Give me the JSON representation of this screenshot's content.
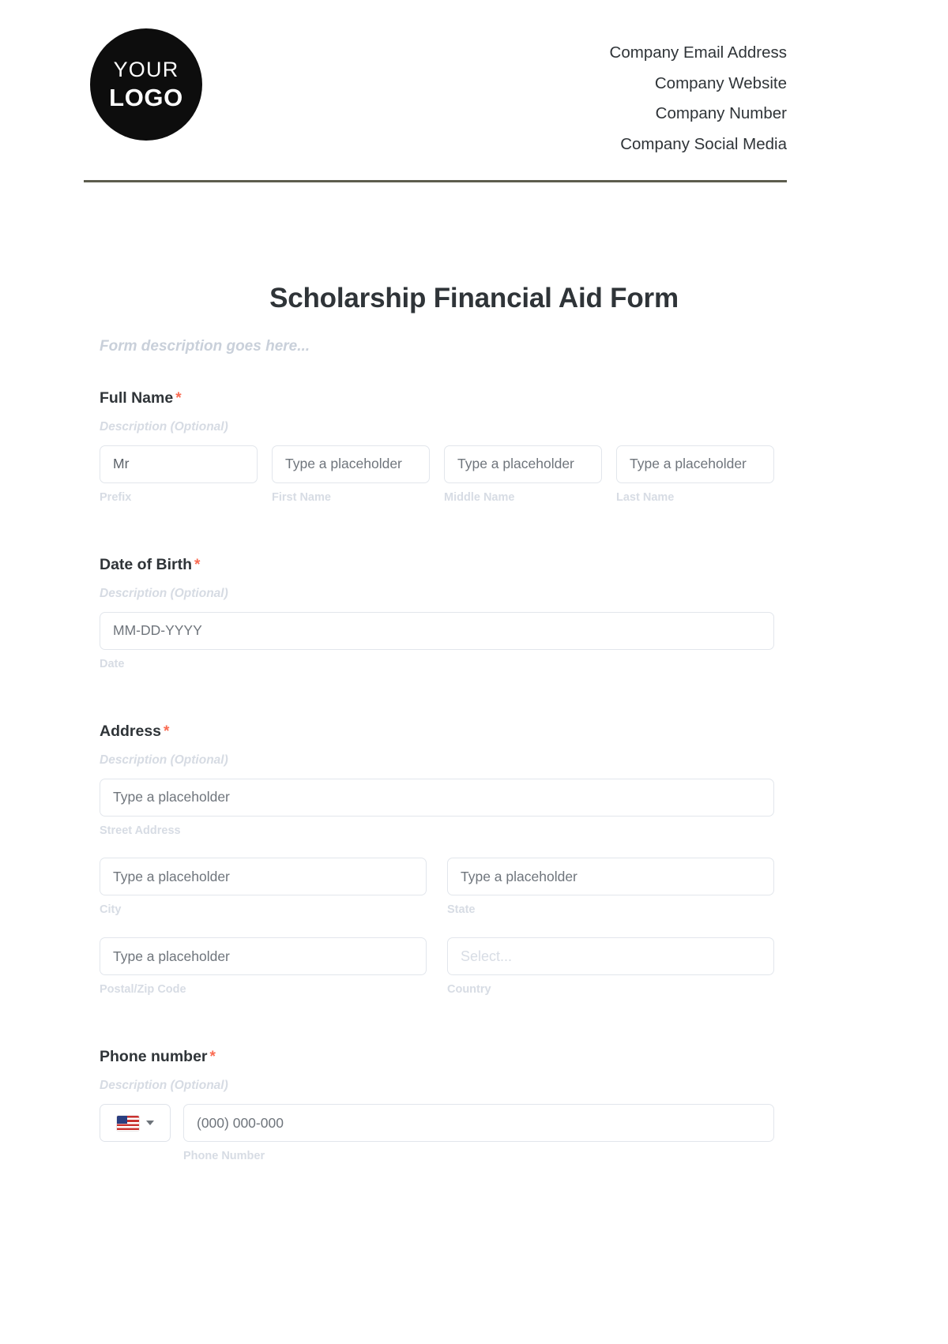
{
  "header": {
    "logo": {
      "line1": "YOUR",
      "line2": "LOGO"
    },
    "contact_lines": [
      "Company Email Address",
      "Company Website",
      "Company Number",
      "Company Social Media"
    ]
  },
  "form": {
    "title": "Scholarship Financial Aid Form",
    "description": "Form description goes here...",
    "required_marker": "*",
    "optional_description": "Description (Optional)",
    "fields": {
      "full_name": {
        "label": "Full Name",
        "description": "Description (Optional)",
        "parts": [
          {
            "value": "Mr",
            "sublabel": "Prefix"
          },
          {
            "value": "Type a placeholder",
            "sublabel": "First Name"
          },
          {
            "value": "Type a placeholder",
            "sublabel": "Middle Name"
          },
          {
            "value": "Type a placeholder",
            "sublabel": "Last Name"
          }
        ]
      },
      "date_of_birth": {
        "label": "Date of Birth",
        "description": "Description (Optional)",
        "value": "MM-DD-YYYY",
        "sublabel": "Date"
      },
      "address": {
        "label": "Address",
        "description": "Description (Optional)",
        "street": {
          "value": "Type a placeholder",
          "sublabel": "Street Address"
        },
        "city": {
          "value": "Type a placeholder",
          "sublabel": "City"
        },
        "state": {
          "value": "Type a placeholder",
          "sublabel": "State"
        },
        "zip": {
          "value": "Type a placeholder",
          "sublabel": "Postal/Zip Code"
        },
        "country": {
          "value": "Select...",
          "sublabel": "Country"
        }
      },
      "phone": {
        "label": "Phone number",
        "description": "Description (Optional)",
        "country_flag": "us-flag-icon",
        "value": "(000) 000-000",
        "sublabel": "Phone Number"
      }
    }
  },
  "colors": {
    "accent_required": "#fa6b52",
    "rule": "#5d5d4e",
    "text_dark": "#2f3438",
    "sublabel": "#d7dce4"
  }
}
